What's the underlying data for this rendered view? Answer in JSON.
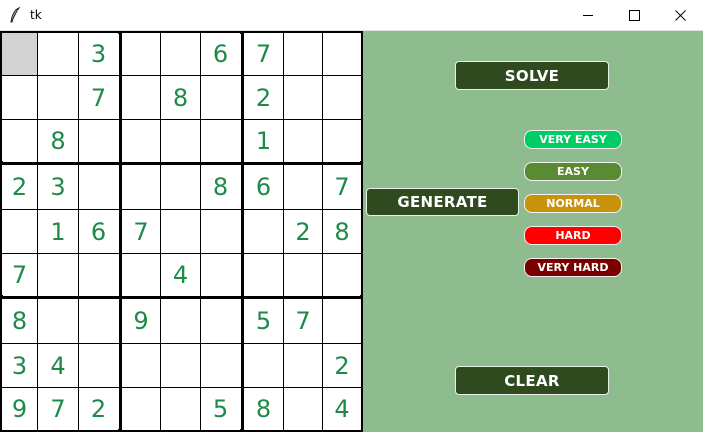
{
  "window": {
    "title": "tk",
    "icon": "feather-icon"
  },
  "board": {
    "selected_cell": [
      0,
      0
    ],
    "digit_color": "#1e8a4a",
    "rows": [
      [
        "",
        "",
        "3",
        "",
        "",
        "6",
        "7",
        "",
        ""
      ],
      [
        "",
        "",
        "7",
        "",
        "8",
        "",
        "2",
        "",
        ""
      ],
      [
        "",
        "8",
        "",
        "",
        "",
        "",
        "1",
        "",
        ""
      ],
      [
        "2",
        "3",
        "",
        "",
        "",
        "8",
        "6",
        "",
        "7"
      ],
      [
        "",
        "1",
        "6",
        "7",
        "",
        "",
        "",
        "2",
        "8"
      ],
      [
        "7",
        "",
        "",
        "",
        "4",
        "",
        "",
        "",
        ""
      ],
      [
        "8",
        "",
        "",
        "9",
        "",
        "",
        "5",
        "7",
        ""
      ],
      [
        "3",
        "4",
        "",
        "",
        "",
        "",
        "",
        "",
        "2"
      ],
      [
        "9",
        "7",
        "2",
        "",
        "",
        "5",
        "8",
        "",
        "4"
      ]
    ]
  },
  "controls": {
    "solve_label": "SOLVE",
    "generate_label": "GENERATE",
    "clear_label": "CLEAR",
    "difficulties": [
      {
        "label": "VERY EASY",
        "color": "#00cc66"
      },
      {
        "label": "EASY",
        "color": "#5a8a32"
      },
      {
        "label": "NORMAL",
        "color": "#c8920a"
      },
      {
        "label": "HARD",
        "color": "#ff0000"
      },
      {
        "label": "VERY HARD",
        "color": "#7a0000"
      }
    ]
  },
  "colors": {
    "panel_bg": "#8fbc8f",
    "button_bg": "#2e4a1e"
  }
}
